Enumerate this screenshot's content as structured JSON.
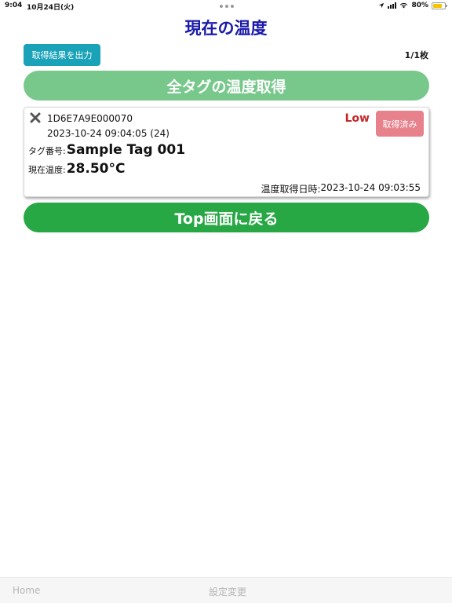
{
  "status_bar": {
    "time": "9:04",
    "date": "10月24日(火)",
    "battery_text": "80%",
    "battery_level": 0.8,
    "battery_color": "#f4c400",
    "icons": [
      "location-arrow-icon",
      "cellular-signal-icon",
      "wifi-icon",
      "battery-icon"
    ]
  },
  "header": {
    "title": "現在の温度",
    "title_color": "#1a1aaa"
  },
  "toolbar": {
    "export_label": "取得結果を出力",
    "page_count": "1/1枚"
  },
  "fetch_all": {
    "label": "全タグの温度取得",
    "color": "#78c88c"
  },
  "tag_card": {
    "id": "1D6E7A9E000070",
    "timestamp": "2023-10-24 09:04:05 (24)",
    "level": "Low",
    "level_color": "#c62828",
    "fetched_label": "取得済み",
    "fetched_color": "#e7828d",
    "tag_number_label": "タグ番号:",
    "tag_number_value": "Sample Tag 001",
    "temp_label": "現在温度:",
    "temp_value": "28.50°C",
    "measured_label": "温度取得日時:",
    "measured_value": "2023-10-24 09:03:55"
  },
  "back_button": {
    "label": "Top画面に戻る",
    "color": "#28a745"
  },
  "bottom_nav": {
    "home": "Home",
    "settings": "設定変更"
  }
}
